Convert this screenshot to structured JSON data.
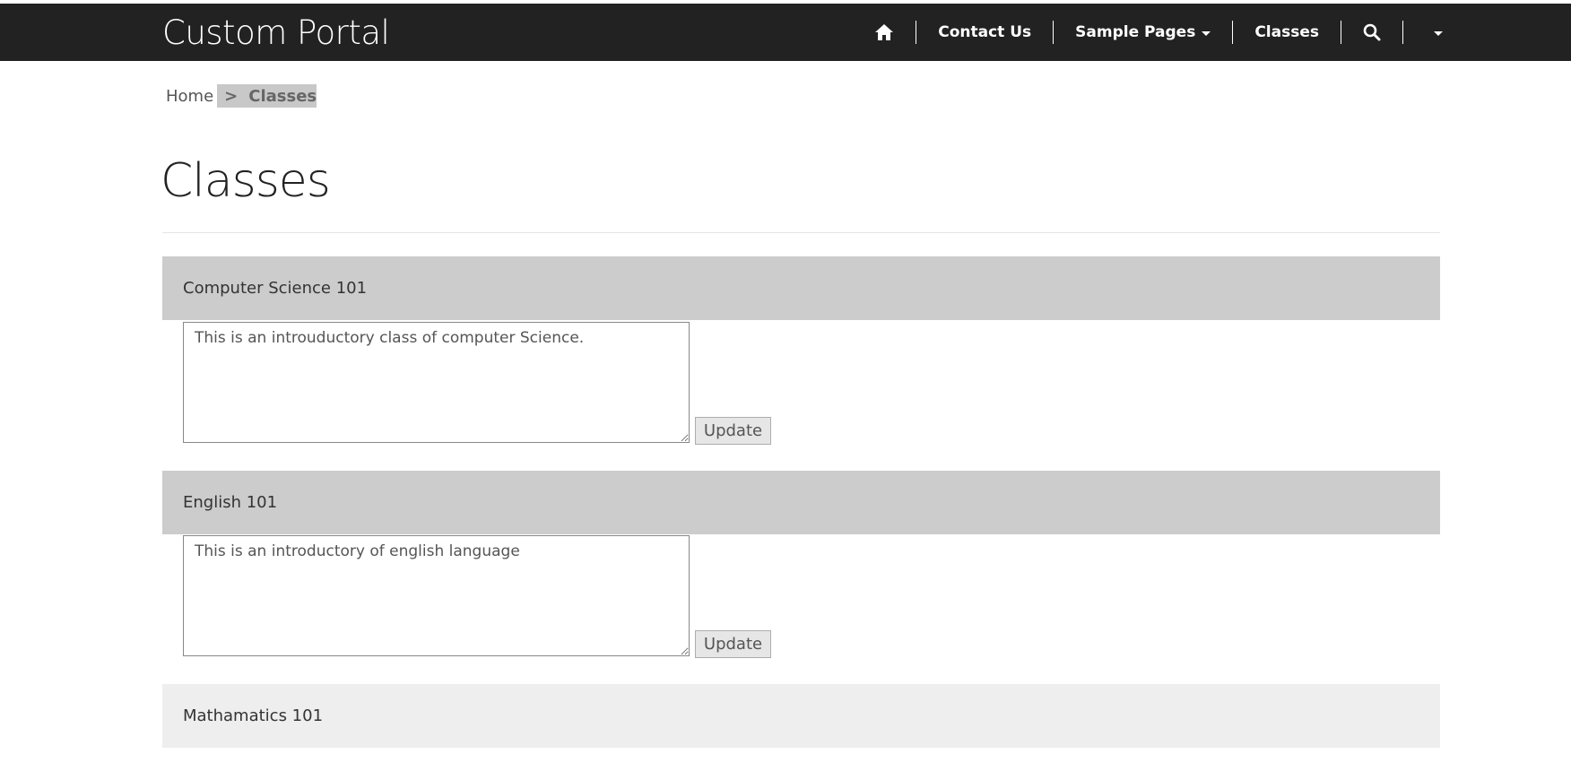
{
  "header": {
    "brand": "Custom Portal",
    "nav": {
      "home_icon": "home-icon",
      "contact_us": "Contact Us",
      "sample_pages": "Sample Pages",
      "classes": "Classes",
      "search_icon": "search-icon",
      "user_dropdown_icon": "caret-down-icon"
    },
    "background_color": "#222222",
    "text_color": "#ffffff"
  },
  "breadcrumb": {
    "home": "Home",
    "separator": ">",
    "current": "Classes"
  },
  "page": {
    "title": "Classes"
  },
  "classes": [
    {
      "name": "Computer Science 101",
      "description": "This is an introuductory class of computer Science.",
      "update_label": "Update",
      "header_color": "#cccccc"
    },
    {
      "name": "English 101",
      "description": "This is an introductory of english language",
      "update_label": "Update",
      "header_color": "#cccccc"
    },
    {
      "name": "Mathamatics 101",
      "header_color": "#eeeeee"
    }
  ]
}
